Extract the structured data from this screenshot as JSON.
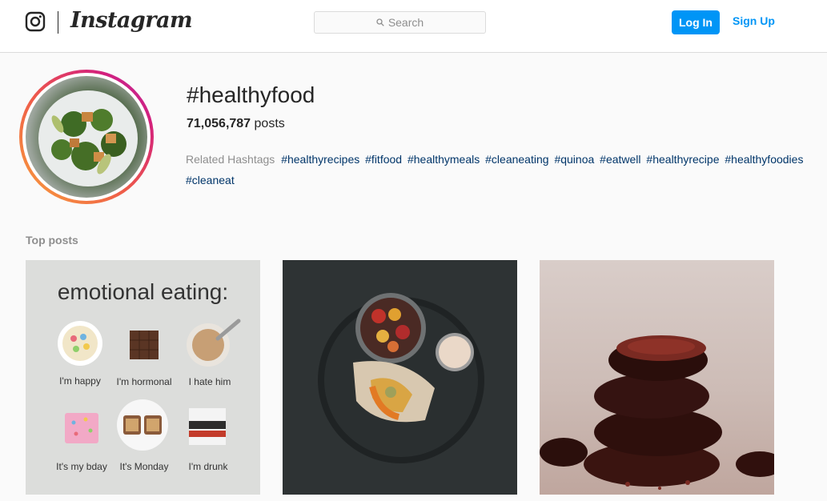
{
  "header": {
    "wordmark": "Instagram",
    "search_placeholder": "Search",
    "login_label": "Log In",
    "signup_label": "Sign Up"
  },
  "profile": {
    "hashtag": "#healthyfood",
    "post_count": "71,056,787",
    "post_unit": "posts",
    "related_label": "Related Hashtags",
    "related_tags": [
      "#healthyrecipes",
      "#fitfood",
      "#healthymeals",
      "#cleaneating",
      "#quinoa",
      "#eatwell",
      "#healthyrecipe",
      "#healthyfoodies",
      "#cleaneat"
    ]
  },
  "top_posts": {
    "label": "Top posts",
    "post1": {
      "title": "emotional eating:",
      "captions": [
        "I'm happy",
        "I'm hormonal",
        "I hate him",
        "It's my bday",
        "It's Monday",
        "I'm drunk"
      ]
    }
  },
  "colors": {
    "accent": "#0095f6",
    "tag": "#003569"
  }
}
